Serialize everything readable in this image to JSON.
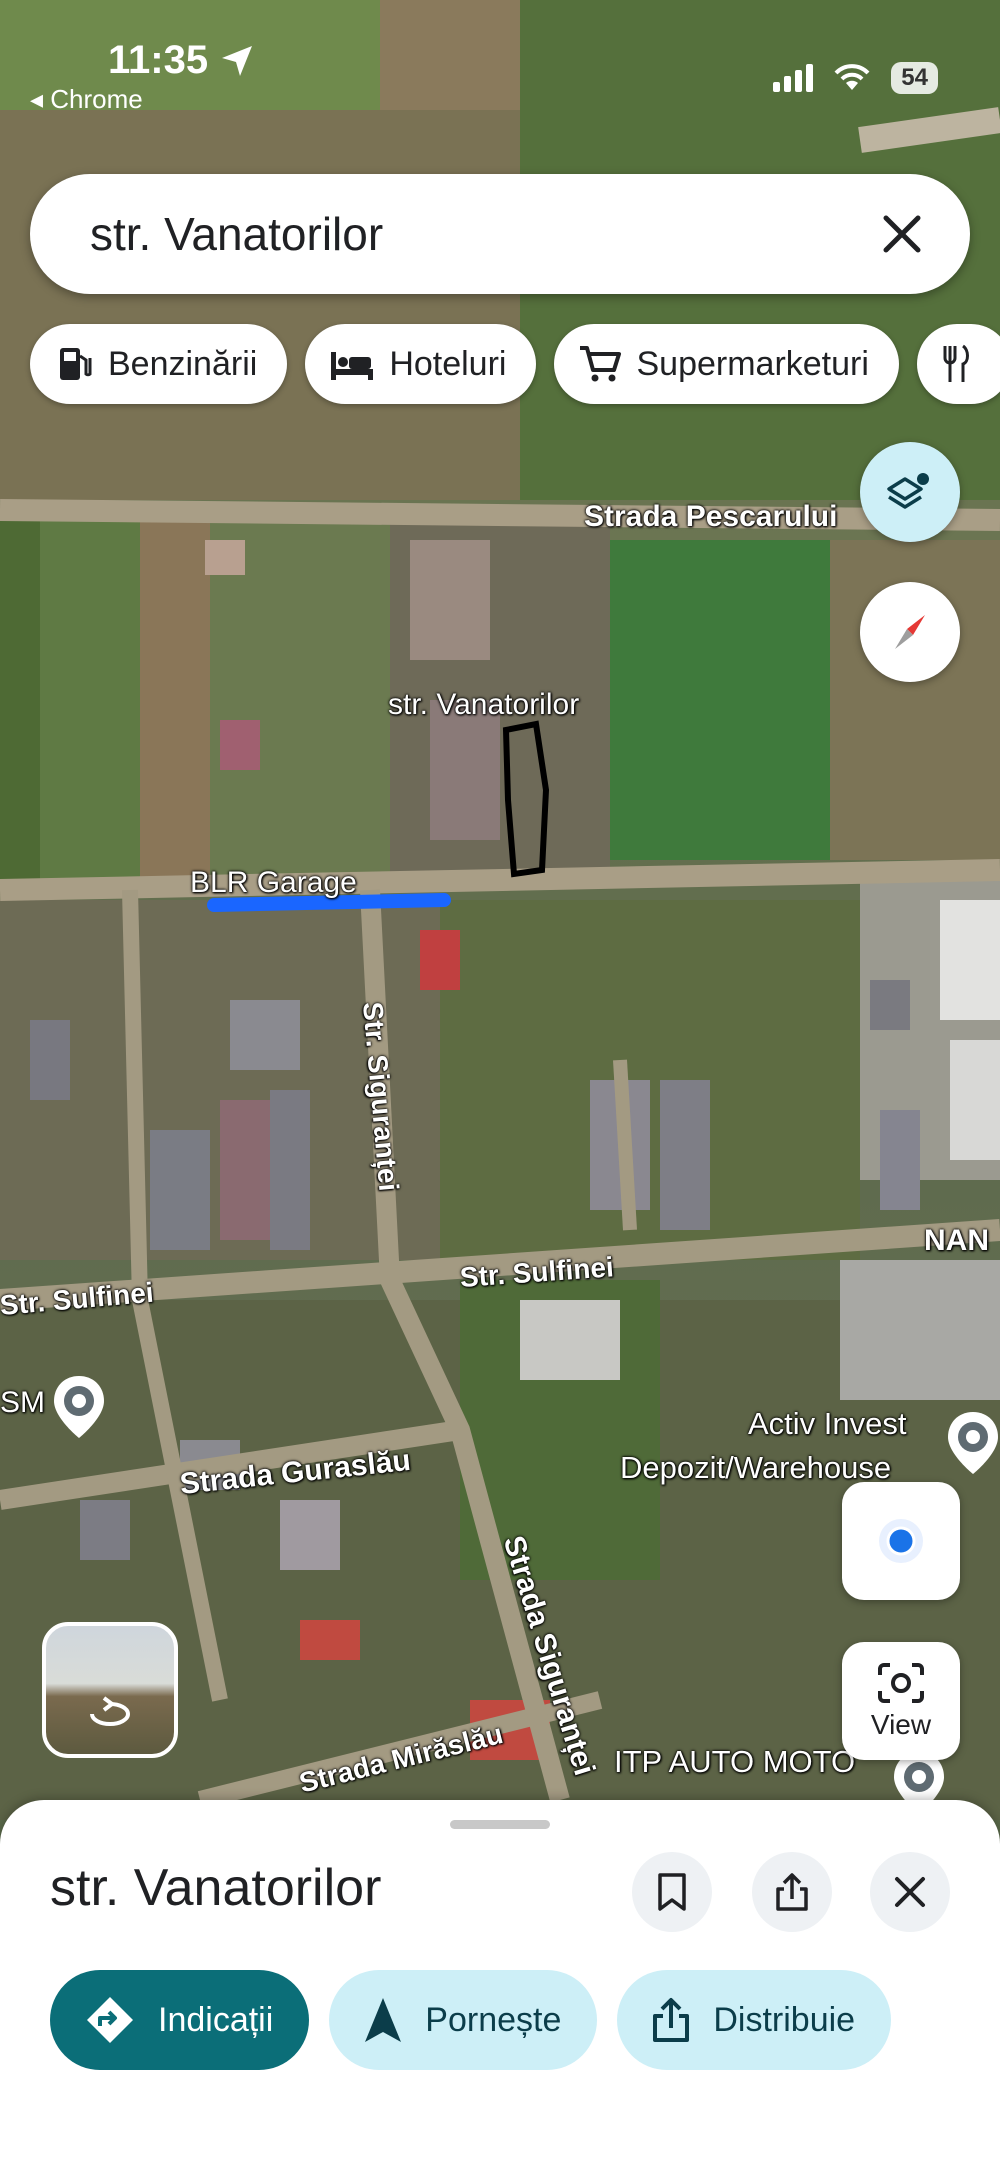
{
  "status_bar": {
    "time": "11:35",
    "back_app": "◂ Chrome",
    "battery": "54"
  },
  "search": {
    "query": "str. Vanatorilor"
  },
  "chips": [
    {
      "label": "Benzinării",
      "icon": "gas-station-icon"
    },
    {
      "label": "Hoteluri",
      "icon": "hotel-bed-icon"
    },
    {
      "label": "Supermarketuri",
      "icon": "shopping-cart-icon"
    }
  ],
  "map": {
    "labels": {
      "pescarului": "Strada Pescarului",
      "vanatorilor": "str. Vanatorilor",
      "garage": "BLR Garage",
      "sigurantei_upper": "Str. Siguranței",
      "sulfinei_left": "Str. Sulfinei",
      "sulfinei_right": "Str. Sulfinei",
      "nan": "NAN",
      "sm": "SM",
      "activ_line1": "Activ Invest",
      "activ_line2": "Depozit/Warehouse",
      "guraslau": "Strada Guraslău",
      "sigurantei_lower": "Strada Siguranței",
      "miraslau": "Strada Mirăslău",
      "itp": "ITP AUTO MOTO"
    },
    "view_label": "View"
  },
  "place_sheet": {
    "title": "str. Vanatorilor",
    "actions": [
      {
        "label": "Indicații",
        "icon": "directions-icon"
      },
      {
        "label": "Pornește",
        "icon": "navigation-arrow-icon"
      },
      {
        "label": "Distribuie",
        "icon": "share-icon"
      }
    ]
  },
  "colors": {
    "primary_action": "#0b6e78",
    "secondary_action": "#cdeff7",
    "location_blue": "#1a73e8"
  }
}
